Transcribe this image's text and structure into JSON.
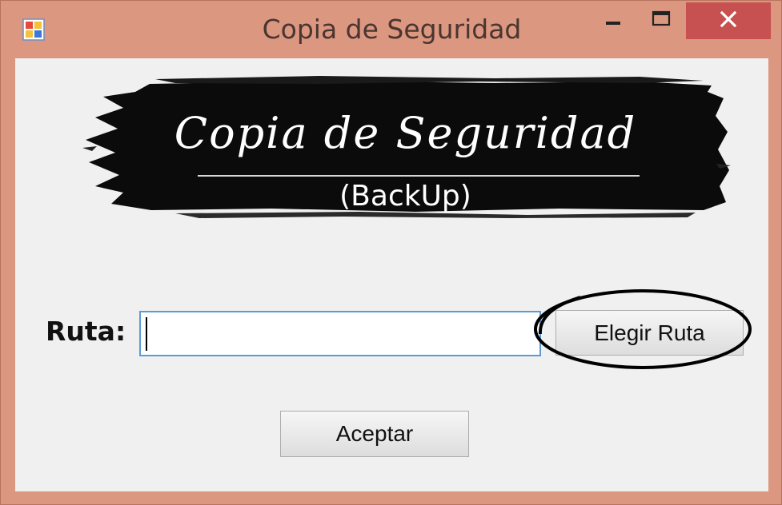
{
  "window": {
    "title": "Copia de Seguridad",
    "titlebar_color": "#dc9780",
    "close_color": "#c75050"
  },
  "banner": {
    "title": "Copia de Seguridad",
    "subtitle": "(BackUp)"
  },
  "form": {
    "ruta_label": "Ruta:",
    "ruta_value": "",
    "elegir_button": "Elegir Ruta",
    "aceptar_button": "Aceptar"
  },
  "icons": {
    "app": "app-icon",
    "minimize": "minimize-icon",
    "maximize": "maximize-icon",
    "close": "close-icon"
  },
  "input_border_color": "#5b9bd5"
}
